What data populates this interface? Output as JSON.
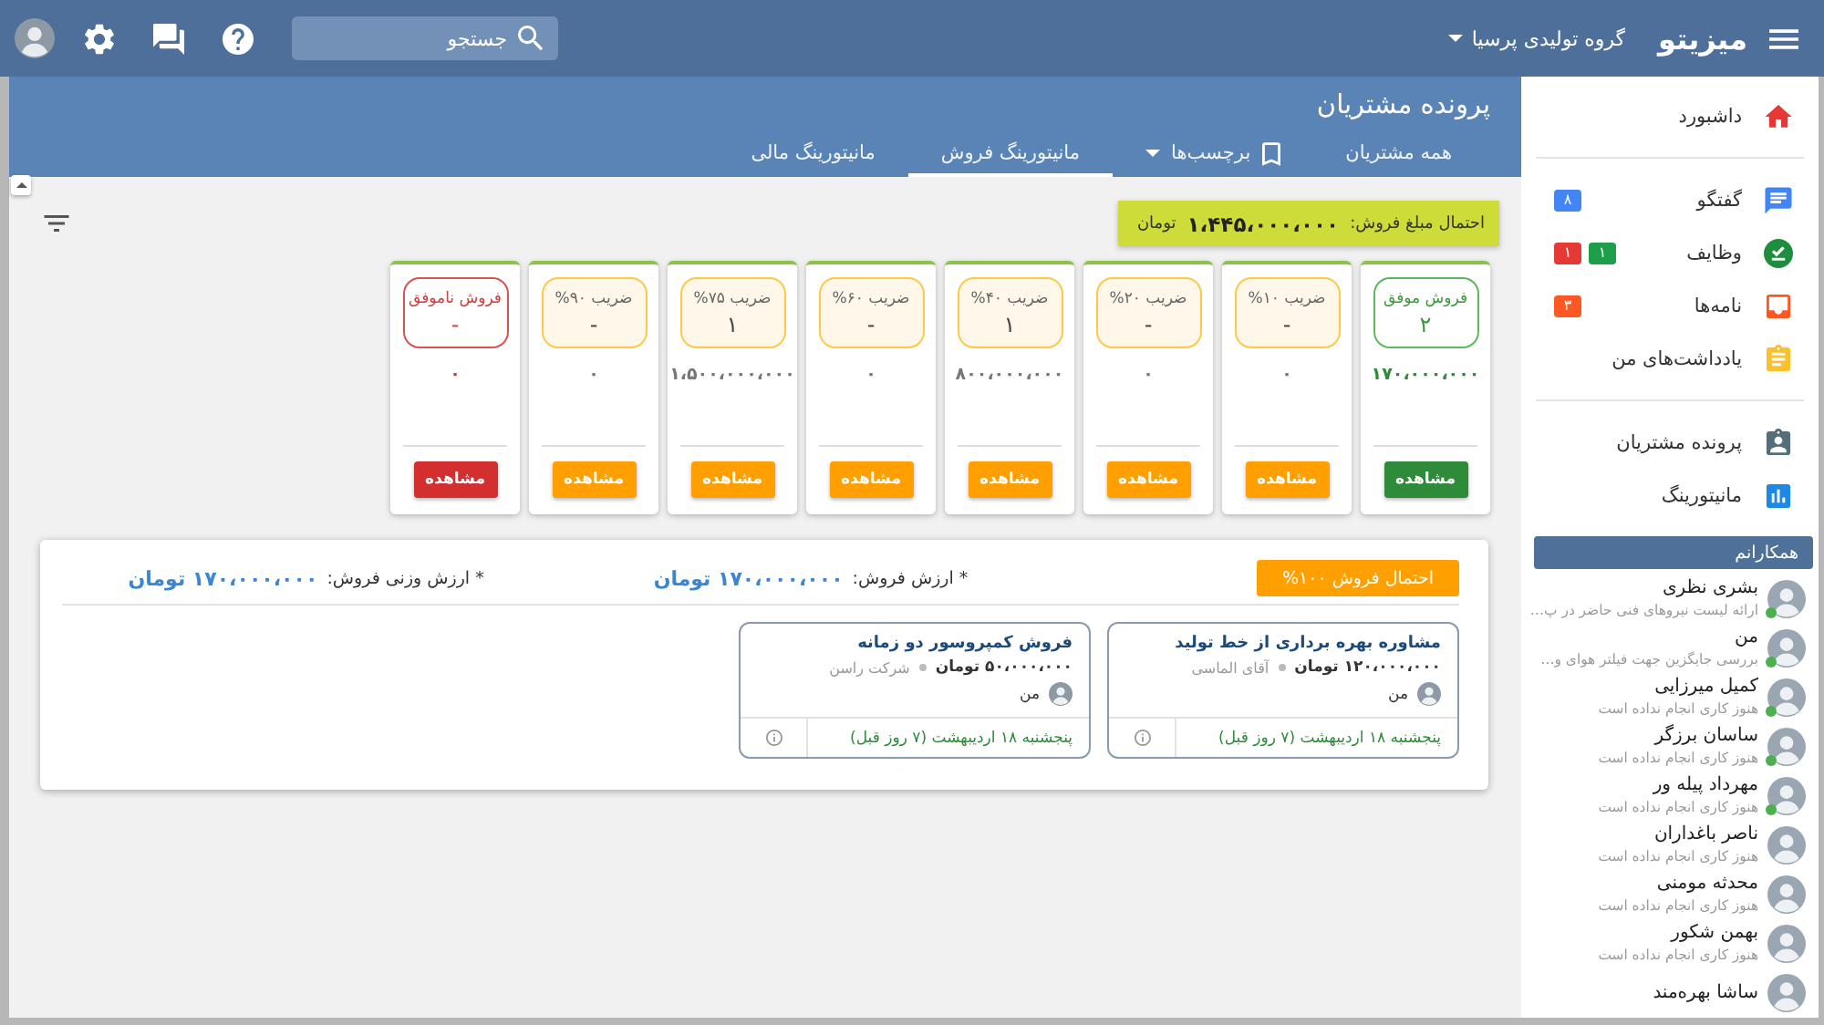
{
  "app_bar": {
    "logo": "میزیتو",
    "company": "گروه تولیدی پرسیا",
    "search": {
      "placeholder": "جستجو"
    }
  },
  "page_header": {
    "title": "پرونده مشتریان",
    "tabs": [
      {
        "label": "همه مشتریان",
        "kind": "link",
        "selected": false
      },
      {
        "label": "برچسب‌ها",
        "kind": "menu",
        "selected": false
      },
      {
        "label": "مانیتورینگ فروش",
        "kind": "link",
        "selected": true
      },
      {
        "label": "مانیتورینگ مالی",
        "kind": "link",
        "selected": false
      }
    ]
  },
  "summary": {
    "label": "احتمال مبلغ فروش:",
    "amount": "۱،۴۴۵،۰۰۰،۰۰۰",
    "currency": "تومان"
  },
  "stages": [
    {
      "kind": "won",
      "title": "فروش موفق",
      "count": "۲",
      "amount": "۱۷۰،۰۰۰،۰۰۰",
      "button": "مشاهده"
    },
    {
      "kind": "stage",
      "title": "ضریب ۱۰%",
      "count": "-",
      "amount": "۰",
      "button": "مشاهده"
    },
    {
      "kind": "stage",
      "title": "ضریب ۲۰%",
      "count": "-",
      "amount": "۰",
      "button": "مشاهده"
    },
    {
      "kind": "stage",
      "title": "ضریب ۴۰%",
      "count": "۱",
      "amount": "۸۰۰،۰۰۰،۰۰۰",
      "button": "مشاهده"
    },
    {
      "kind": "stage",
      "title": "ضریب ۶۰%",
      "count": "-",
      "amount": "۰",
      "button": "مشاهده"
    },
    {
      "kind": "stage",
      "title": "ضریب ۷۵%",
      "count": "۱",
      "amount": "۱،۵۰۰،۰۰۰،۰۰۰",
      "button": "مشاهده"
    },
    {
      "kind": "stage",
      "title": "ضریب ۹۰%",
      "count": "-",
      "amount": "۰",
      "button": "مشاهده"
    },
    {
      "kind": "lost",
      "title": "فروش ناموفق",
      "count": "-",
      "amount": "۰",
      "button": "مشاهده"
    }
  ],
  "detail": {
    "badge": "احتمال فروش ۱۰۰%",
    "stats": [
      {
        "label": "* ارزش فروش:",
        "value": "۱۷۰،۰۰۰،۰۰۰ تومان"
      },
      {
        "label": "* ارزش وزنی فروش:",
        "value": "۱۷۰،۰۰۰،۰۰۰ تومان"
      }
    ],
    "deals": [
      {
        "title": "مشاوره بهره برداری از خط تولید",
        "amount": "۱۲۰،۰۰۰،۰۰۰ تومان",
        "contact": "آقای الماسی",
        "owner": "من",
        "date": "پنجشنبه ۱۸ اردیبهشت (۷ روز قبل)"
      },
      {
        "title": "فروش کمپروسور دو زمانه",
        "amount": "۵۰،۰۰۰،۰۰۰ تومان",
        "contact": "شرکت راسن",
        "owner": "من",
        "date": "پنجشنبه ۱۸ اردیبهشت (۷ روز قبل)"
      }
    ]
  },
  "sidebar": {
    "groups": [
      {
        "items": [
          {
            "label": "داشبورد"
          }
        ]
      },
      {
        "items": [
          {
            "label": "گفتگو",
            "badges": [
              {
                "text": "۸",
                "color": "#4285f4"
              }
            ]
          },
          {
            "label": "وظایف",
            "badges": [
              {
                "text": "۱",
                "color": "#1e9e4a"
              },
              {
                "text": "۱",
                "color": "#e53935"
              }
            ]
          },
          {
            "label": "نامه‌ها",
            "badges": [
              {
                "text": "۳",
                "color": "#ff5722"
              }
            ]
          },
          {
            "label": "یادداشت‌های من"
          }
        ]
      },
      {
        "items": [
          {
            "label": "پرونده مشتریان"
          },
          {
            "label": "مانیتورینگ"
          }
        ]
      }
    ]
  },
  "colleagues": {
    "title": "همکارانم",
    "items": [
      {
        "name": "بشری نظری",
        "status": "ارائه لیست نیروهای فنی حاضر در پ…",
        "online": true
      },
      {
        "name": "من",
        "status": "بررسی جایگزین جهت فیلتر هوای و…",
        "online": true
      },
      {
        "name": "کمیل میرزایی",
        "status": "هنوز کاری انجام نداده است",
        "online": true
      },
      {
        "name": "ساسان برزگر",
        "status": "هنوز کاری انجام نداده است",
        "online": true
      },
      {
        "name": "مهرداد پیله ور",
        "status": "هنوز کاری انجام نداده است",
        "online": true
      },
      {
        "name": "ناصر باغداران",
        "status": "هنوز کاری انجام نداده است",
        "online": false
      },
      {
        "name": "محدثه مومنی",
        "status": "هنوز کاری انجام نداده است",
        "online": false
      },
      {
        "name": "بهمن شکور",
        "status": "هنوز کاری انجام نداده است",
        "online": false
      },
      {
        "name": "ساشا بهره‌مند",
        "online": false
      }
    ]
  }
}
